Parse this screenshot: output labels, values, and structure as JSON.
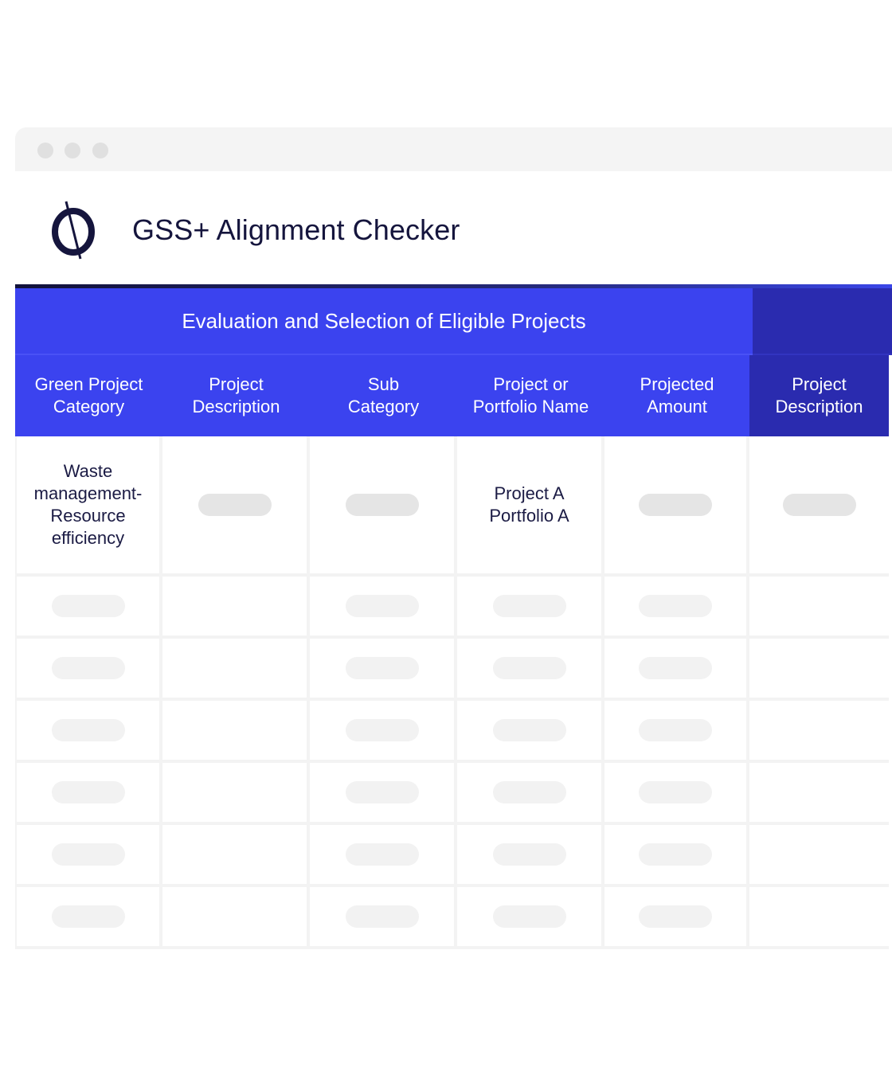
{
  "window": {
    "controls": [
      "window-dot-1",
      "window-dot-2",
      "window-dot-3"
    ]
  },
  "app": {
    "title": "GSS+ Alignment Checker",
    "logo_icon": "circle-slash-logo-icon"
  },
  "table": {
    "group_header": "Evaluation and Selection of Eligible Projects",
    "columns": [
      "Green Project\nCategory",
      "Project\nDescription",
      "Sub\nCategory",
      "Project or\nPortfolio Name",
      "Projected\nAmount",
      "Project\nDescription"
    ],
    "rows": [
      [
        "Waste\nmanagement-\nResource\nefficiency",
        "",
        "",
        "Project A\nPortfolio A",
        "",
        ""
      ]
    ],
    "placeholder_rows": 6
  },
  "colors": {
    "header_blue": "#3b43ef",
    "header_dark_blue": "#2a2baf",
    "accent_navy": "#15153d",
    "placeholder_grey": "#e5e5e5"
  }
}
